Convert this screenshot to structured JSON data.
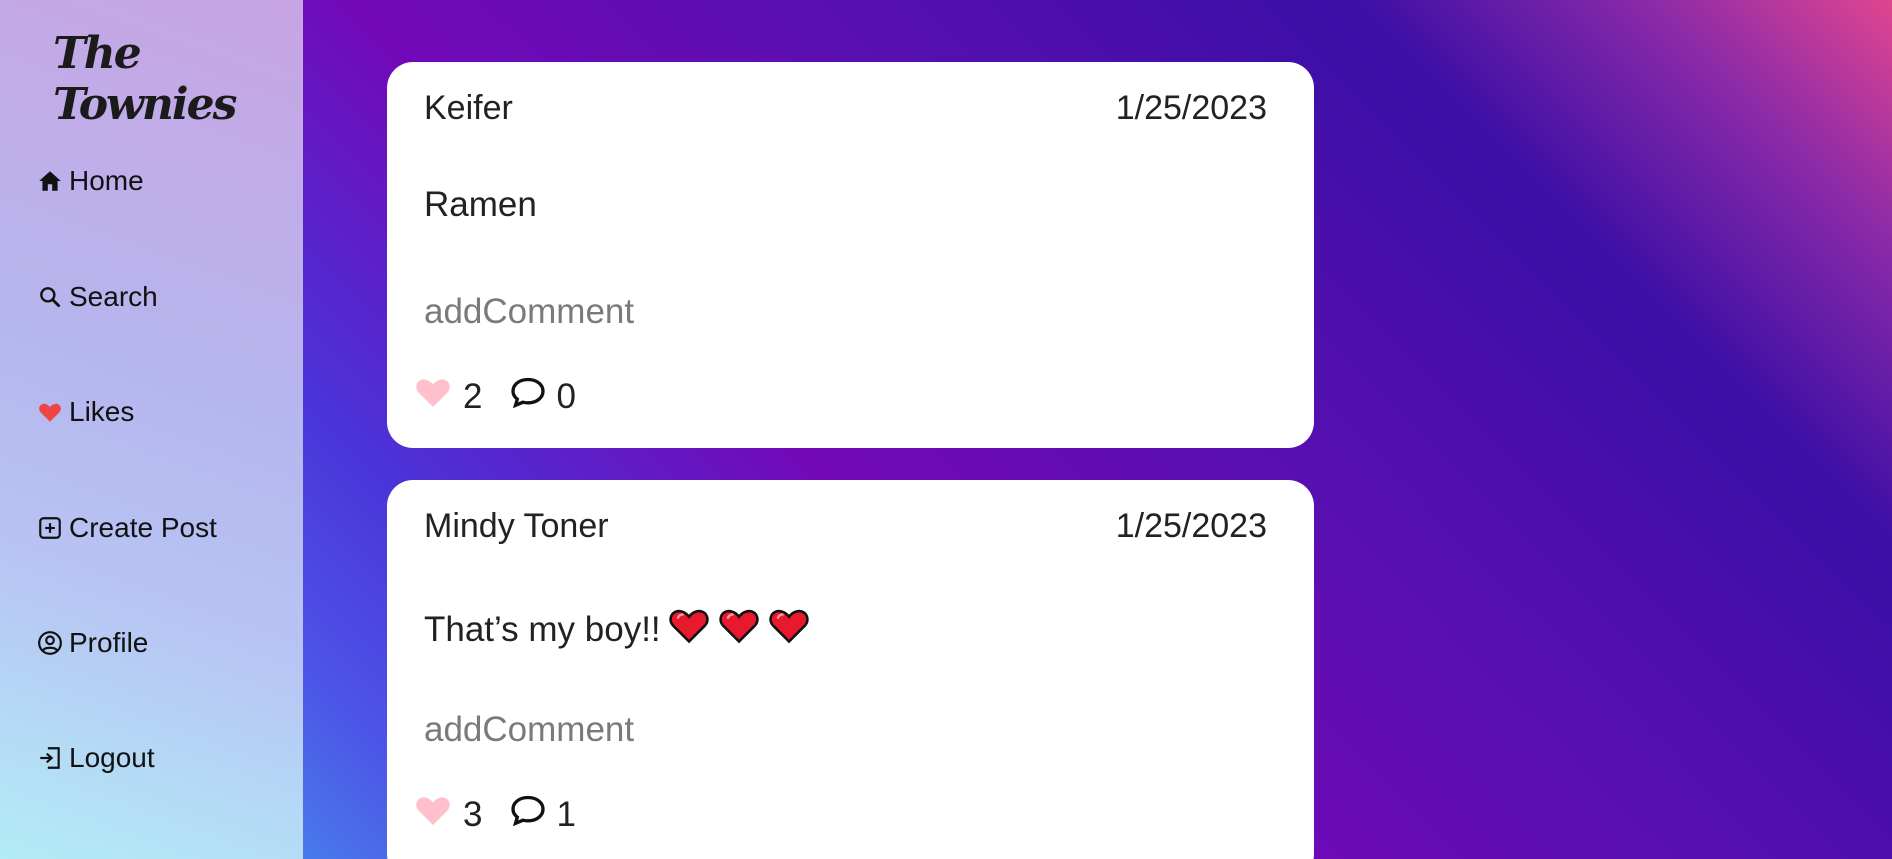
{
  "app": {
    "title": "The Townies"
  },
  "sidebar": {
    "items": [
      {
        "label": "Home",
        "icon": "home-icon"
      },
      {
        "label": "Search",
        "icon": "search-icon"
      },
      {
        "label": "Likes",
        "icon": "heart-icon"
      },
      {
        "label": "Create Post",
        "icon": "plus-square-icon"
      },
      {
        "label": "Profile",
        "icon": "user-circle-icon"
      },
      {
        "label": "Logout",
        "icon": "logout-icon"
      }
    ]
  },
  "posts": [
    {
      "author": "Keifer",
      "date": "1/25/2023",
      "content": "Ramen",
      "comment_placeholder": "addComment",
      "likes": "2",
      "comments": "0"
    },
    {
      "author": "Mindy Toner",
      "date": "1/25/2023",
      "content": "That’s my boy!!",
      "emoji": [
        "red-heart",
        "red-heart",
        "red-heart"
      ],
      "comment_placeholder": "addComment",
      "likes": "3",
      "comments": "1"
    }
  ],
  "colors": {
    "like": "#ffc0cb",
    "heart_icon": "#f04545",
    "placeholder": "#7a7a7a"
  }
}
